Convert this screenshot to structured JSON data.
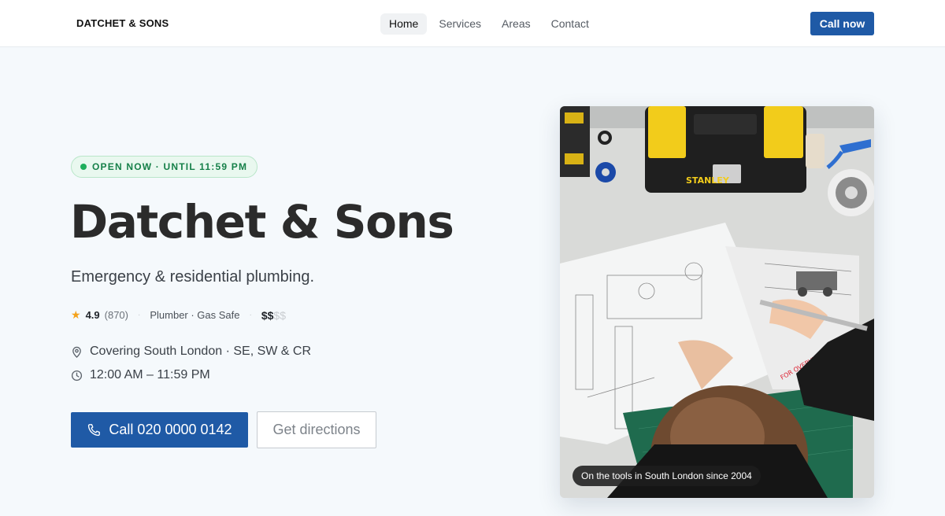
{
  "header": {
    "brand": "DATCHET & SONS",
    "nav": [
      {
        "label": "Home",
        "active": true
      },
      {
        "label": "Services",
        "active": false
      },
      {
        "label": "Areas",
        "active": false
      },
      {
        "label": "Contact",
        "active": false
      }
    ],
    "cta_label": "Call now"
  },
  "hero": {
    "status": "OPEN NOW · UNTIL 11:59 PM",
    "title": "Datchet & Sons",
    "subtitle": "Emergency & residential plumbing.",
    "rating": "4.9",
    "reviews": "(870)",
    "categories": "Plumber · Gas Safe",
    "price_active": "$$",
    "price_inactive": "$$",
    "location": "Covering South London · SE, SW & CR",
    "hours": "12:00 AM – 11:59 PM",
    "call_button": "Call 020 0000 0142",
    "directions_button": "Get directions"
  },
  "photo": {
    "caption": "On the tools in South London since 2004",
    "toolbox_brand": "STANLEY",
    "stamp_text": "FOR OVERVIEW"
  },
  "colors": {
    "accent": "#1f5aa6",
    "open_green": "#1fae5c",
    "star": "#f4a21a"
  },
  "icons": {
    "rating": "star-icon",
    "location": "map-pin-icon",
    "hours": "clock-icon",
    "call": "phone-icon"
  }
}
